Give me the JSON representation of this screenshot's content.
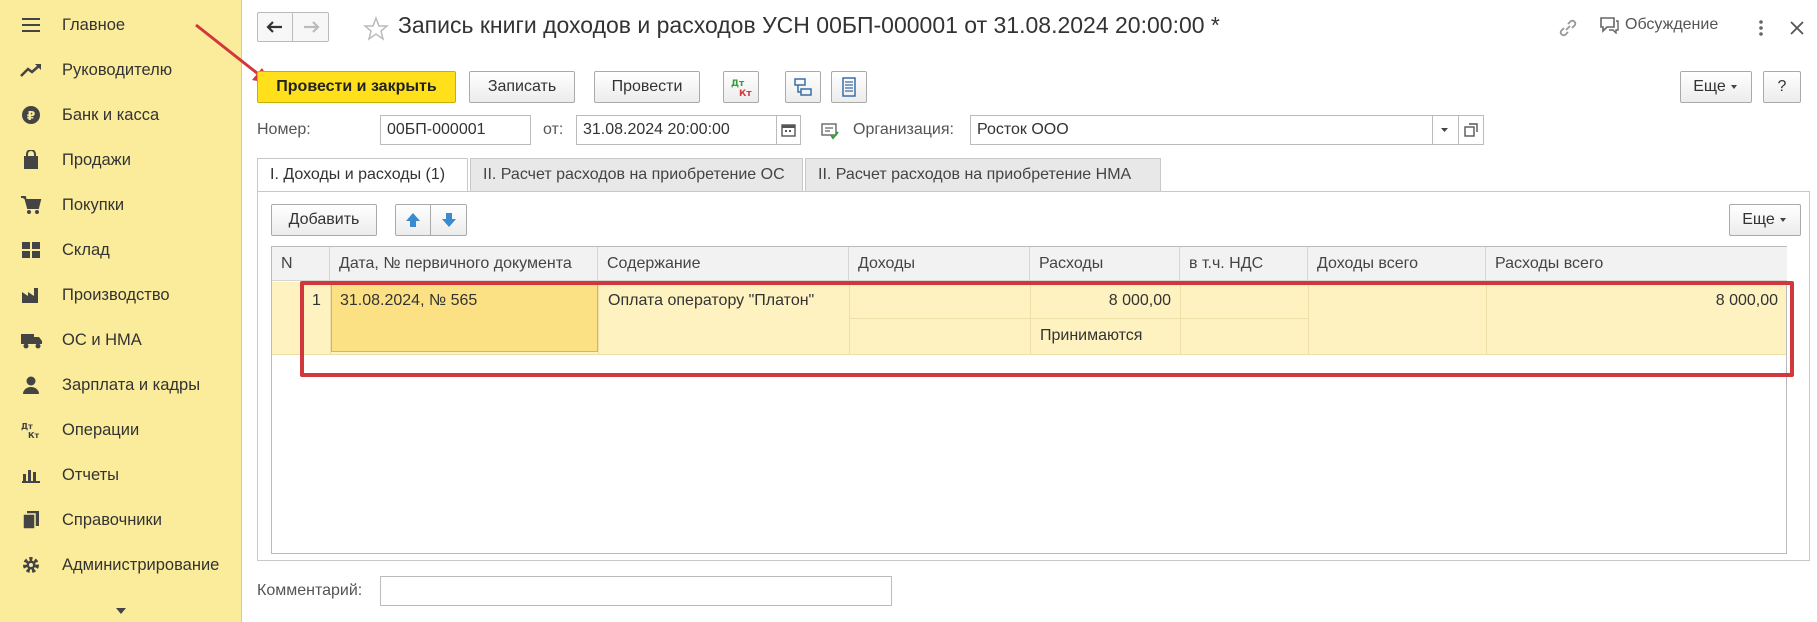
{
  "sidebar": {
    "items": [
      {
        "label": "Главное",
        "icon": "menu-icon"
      },
      {
        "label": "Руководителю",
        "icon": "trend-icon"
      },
      {
        "label": "Банк и касса",
        "icon": "ruble-coin-icon"
      },
      {
        "label": "Продажи",
        "icon": "shopping-bag-icon"
      },
      {
        "label": "Покупки",
        "icon": "cart-icon"
      },
      {
        "label": "Склад",
        "icon": "warehouse-icon"
      },
      {
        "label": "Производство",
        "icon": "factory-icon"
      },
      {
        "label": "ОС и НМА",
        "icon": "truck-icon"
      },
      {
        "label": "Зарплата и кадры",
        "icon": "person-icon"
      },
      {
        "label": "Операции",
        "icon": "dt-kt-icon"
      },
      {
        "label": "Отчеты",
        "icon": "bar-chart-icon"
      },
      {
        "label": "Справочники",
        "icon": "books-icon"
      },
      {
        "label": "Администрирование",
        "icon": "gear-icon"
      }
    ]
  },
  "header": {
    "title": "Запись книги доходов и расходов УСН 00БП-000001 от 31.08.2024 20:00:00 *",
    "discussion": "Обсуждение"
  },
  "toolbar": {
    "post_close": "Провести и закрыть",
    "save": "Записать",
    "post": "Провести",
    "dt_icon": "Дт",
    "kt_icon": "Кт",
    "more": "Еще",
    "help": "?"
  },
  "form": {
    "number_label": "Номер:",
    "number_value": "00БП-000001",
    "date_label": "от:",
    "date_value": "31.08.2024 20:00:00",
    "org_label": "Организация:",
    "org_value": "Росток ООО",
    "comment_label": "Комментарий:",
    "comment_value": ""
  },
  "tabs": [
    {
      "label": "I. Доходы и расходы (1)",
      "active": true
    },
    {
      "label": "II. Расчет расходов на приобретение ОС",
      "active": false
    },
    {
      "label": "II. Расчет расходов на приобретение НМА",
      "active": false
    }
  ],
  "table_toolbar": {
    "add": "Добавить",
    "more": "Еще"
  },
  "table": {
    "columns": [
      "N",
      "Дата, № первичного документа",
      "Содержание",
      "Доходы",
      "Расходы",
      "в т.ч. НДС",
      "Доходы всего",
      "Расходы всего"
    ],
    "rows": [
      {
        "n": "1",
        "doc": "31.08.2024, № 565",
        "content": "Оплата оператору \"Платон\"",
        "income": "",
        "expense": "8 000,00",
        "expense_status": "Принимаются",
        "vat": "",
        "income_total": "",
        "expense_total": "8 000,00"
      }
    ]
  },
  "colors": {
    "sidebar_bg": "#fbec9c",
    "primary_button": "#ffe01a",
    "row_highlight": "#fdf2c0",
    "selected_cell": "#fbe183",
    "annotation_red": "#d2373c",
    "arrow_blue": "#3a8ad0"
  }
}
